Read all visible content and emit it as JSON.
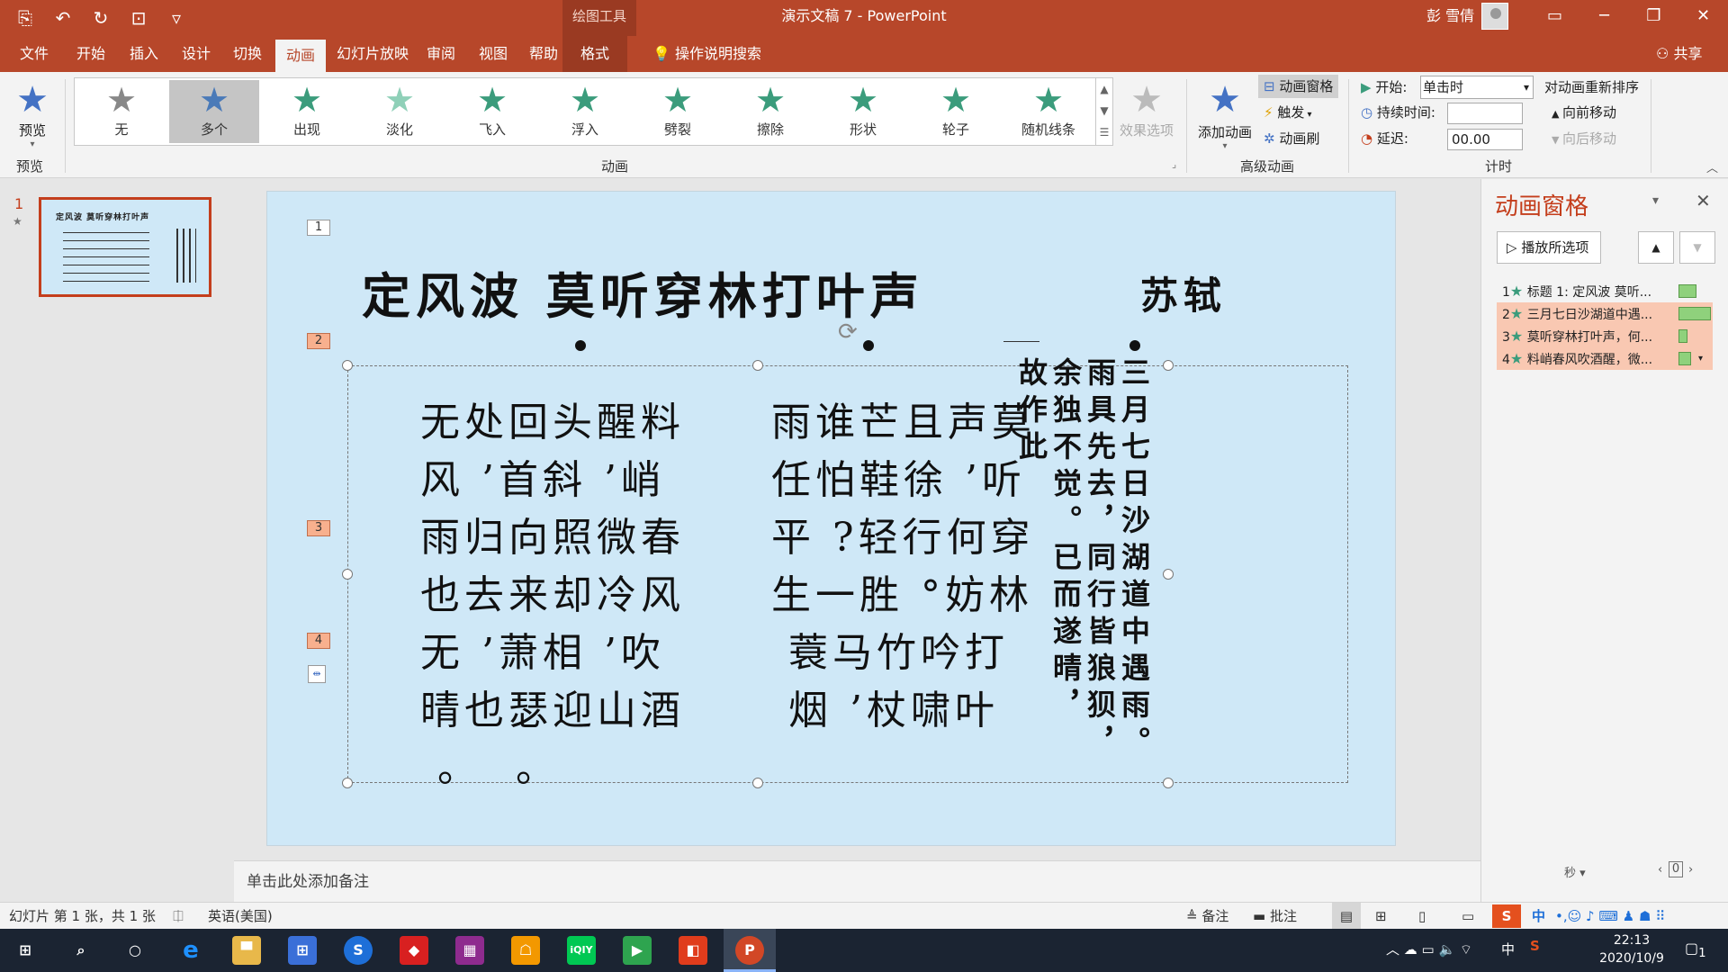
{
  "window": {
    "title": "演示文稿 7  -  PowerPoint",
    "context_tab_group": "绘图工具",
    "user": "彭 雪倩"
  },
  "tabs": [
    "文件",
    "开始",
    "插入",
    "设计",
    "切换",
    "动画",
    "幻灯片放映",
    "审阅",
    "视图",
    "帮助",
    "格式"
  ],
  "active_tab": "动画",
  "tell_me": "操作说明搜索",
  "share": "共享",
  "ribbon": {
    "preview": {
      "label": "预览",
      "group": "预览"
    },
    "animations": [
      {
        "label": "无",
        "color": "#888888"
      },
      {
        "label": "多个",
        "color": "#4a7ab8"
      },
      {
        "label": "出现",
        "color": "#3b9c7c"
      },
      {
        "label": "淡化",
        "color": "#8fd0b8"
      },
      {
        "label": "飞入",
        "color": "#3b9c7c"
      },
      {
        "label": "浮入",
        "color": "#3b9c7c"
      },
      {
        "label": "劈裂",
        "color": "#3b9c7c"
      },
      {
        "label": "擦除",
        "color": "#3b9c7c"
      },
      {
        "label": "形状",
        "color": "#3b9c7c"
      },
      {
        "label": "轮子",
        "color": "#3b9c7c"
      },
      {
        "label": "随机线条",
        "color": "#3b9c7c"
      }
    ],
    "selected_animation": "多个",
    "effect_options": "效果选项",
    "animation_group": "动画",
    "advanced": {
      "add_animation": "添加动画",
      "pane": "动画窗格",
      "trigger": "触发",
      "painter": "动画刷",
      "group": "高级动画"
    },
    "timing": {
      "start_label": "开始:",
      "start_value": "单击时",
      "duration_label": "持续时间:",
      "duration_value": "",
      "delay_label": "延迟:",
      "delay_value": "00.00",
      "reorder": "对动画重新排序",
      "move_earlier": "向前移动",
      "move_later": "向后移动",
      "group": "计时"
    }
  },
  "thumbnail": {
    "number": "1"
  },
  "slide": {
    "title": "定风波  莫听穿林打叶声",
    "author": "苏轼",
    "markers": [
      "1",
      "2",
      "3",
      "4"
    ],
    "poem_left": "无处回头醒料\n风 ’首斜 ’峭\n雨归向照微春\n也去来却冷风\n无 ’萧相 ’吹\n晴也瑟迎山酒\n 。  。",
    "poem_mid": "雨谁芒且声莫\n任怕鞋徐 ’听\n平 ?轻行何穿\n生一胜 °妨林\n 蓑马竹吟打\n 烟 ’杖啸叶",
    "preface_cols": [
      "三月七日沙湖道中遇雨。",
      "雨具先去，同行皆狼狈，",
      "余独不觉。已而遂晴，",
      "故作此"
    ]
  },
  "notes_placeholder": "单击此处添加备注",
  "anim_pane": {
    "title": "动画窗格",
    "play": "播放所选项",
    "items": [
      {
        "num": "1",
        "text": "标题 1: 定风波  莫听..."
      },
      {
        "num": "2",
        "text": "三月七日沙湖道中遇..."
      },
      {
        "num": "3",
        "text": "莫听穿林打叶声，何..."
      },
      {
        "num": "4",
        "text": "料峭春风吹酒醒，微..."
      }
    ],
    "seconds": "秒",
    "page": "0"
  },
  "status": {
    "slide_info": "幻灯片 第 1 张，共 1 张",
    "language": "英语(美国)",
    "notes": "备注",
    "comments": "批注"
  },
  "taskbar": {
    "time": "22:13",
    "date": "2020/10/9",
    "ime": "中",
    "notif": "1"
  }
}
